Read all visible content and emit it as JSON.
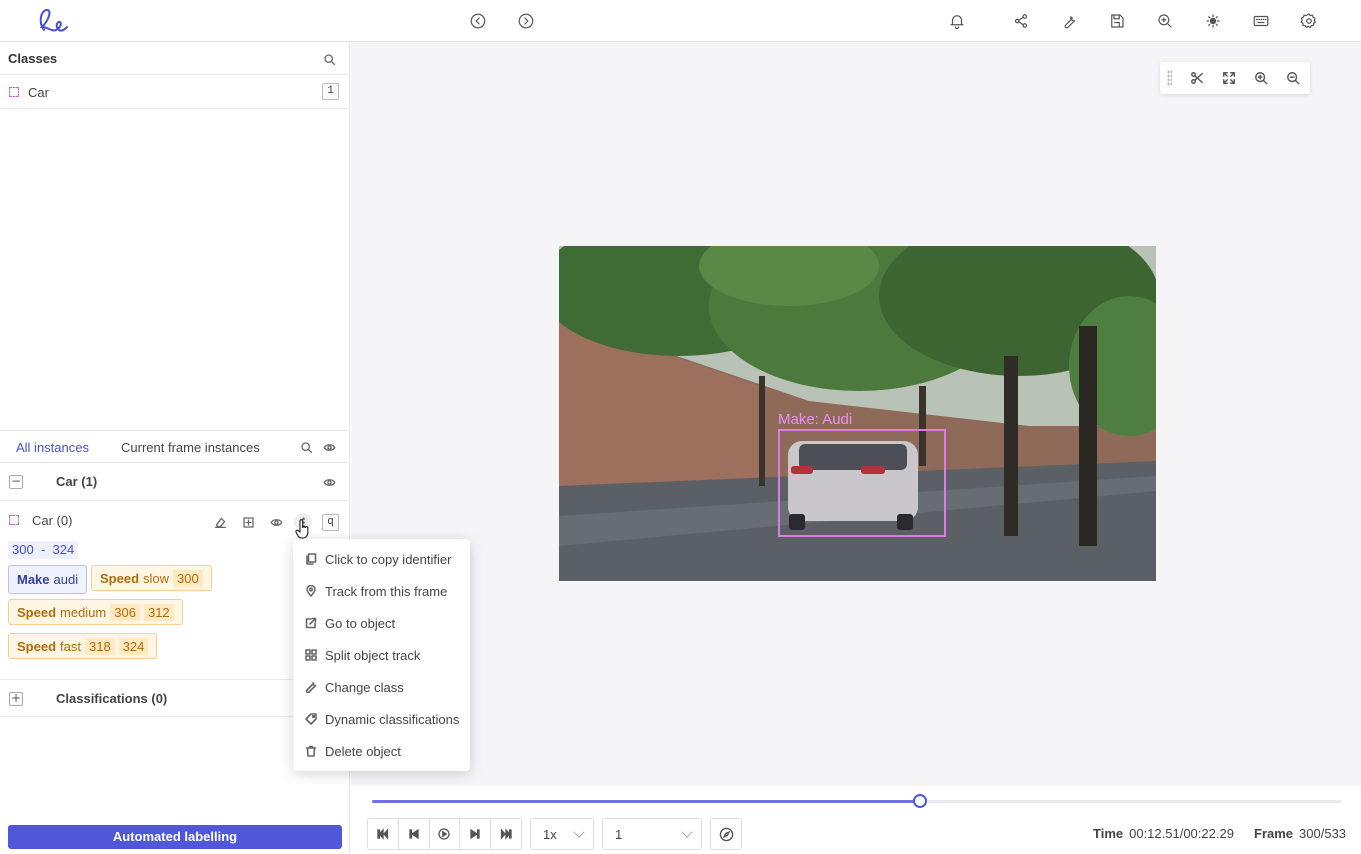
{
  "classes_panel": {
    "title": "Classes",
    "classes": [
      {
        "name": "Car",
        "hotkey": "1"
      }
    ]
  },
  "instances_panel": {
    "tabs": [
      {
        "label": "All instances"
      },
      {
        "label": "Current frame instances"
      }
    ],
    "groups": [
      {
        "label": "Car (1)"
      }
    ],
    "object": {
      "name": "Car (0)",
      "hotkey": "q",
      "range_start": "300",
      "range_sep": "-",
      "range_end": "324",
      "attributes": [
        {
          "key": "Make",
          "value": "audi",
          "frames": []
        },
        {
          "key": "Speed",
          "value": "slow",
          "frames": [
            "300"
          ]
        },
        {
          "key": "Speed",
          "value": "medium",
          "frames": [
            "306",
            "312"
          ]
        },
        {
          "key": "Speed",
          "value": "fast",
          "frames": [
            "318",
            "324"
          ]
        }
      ]
    },
    "classifications_label": "Classifications (0)"
  },
  "context_menu": {
    "items": [
      {
        "label": "Click to copy identifier",
        "icon": "copy-icon"
      },
      {
        "label": "Track from this frame",
        "icon": "map-pin-icon"
      },
      {
        "label": "Go to object",
        "icon": "go-to-icon"
      },
      {
        "label": "Split object track",
        "icon": "split-icon"
      },
      {
        "label": "Change class",
        "icon": "wrench-icon"
      },
      {
        "label": "Dynamic classifications",
        "icon": "tag-icon"
      },
      {
        "label": "Delete object",
        "icon": "trash-icon"
      }
    ]
  },
  "canvas": {
    "annotation_label": "Make: Audi",
    "annotation_color": "#e07ae6"
  },
  "timeline": {
    "progress": 0.5647,
    "speed": "1x",
    "step": "1",
    "time_label": "Time",
    "time_value": "00:12.51/00:22.29",
    "frame_label": "Frame",
    "frame_value": "300/533"
  },
  "automated_labelling_label": "Automated labelling",
  "colors": {
    "accent": "#5057d9",
    "attribute_chip": "#fff6e5",
    "make_chip": "#f0f2ff"
  }
}
